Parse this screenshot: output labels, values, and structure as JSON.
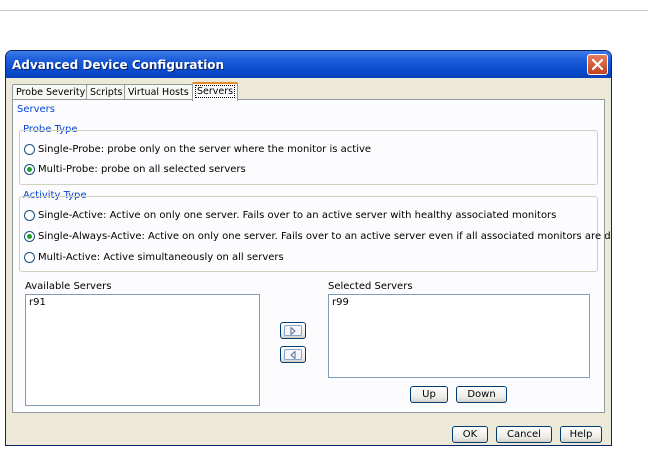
{
  "dialog": {
    "title": "Advanced Device Configuration"
  },
  "tabs": [
    "Probe Severity",
    "Scripts",
    "Virtual Hosts",
    "Servers"
  ],
  "active_tab": "Servers",
  "servers_section": {
    "title": "Servers",
    "probe_type": {
      "title": "Probe Type",
      "options": [
        {
          "label": "Single-Probe: probe only on the server where the monitor is active",
          "selected": false
        },
        {
          "label": "Multi-Probe: probe on all selected servers",
          "selected": true
        }
      ]
    },
    "activity_type": {
      "title": "Activity Type",
      "options": [
        {
          "label": "Single-Active: Active on only one server. Fails over to an active server with healthy associated monitors",
          "selected": false
        },
        {
          "label": "Single-Always-Active: Active on only one server. Fails over to an active server even if all associated monitors are down",
          "selected": true
        },
        {
          "label": "Multi-Active: Active simultaneously on all servers",
          "selected": false
        }
      ]
    },
    "available_servers": {
      "label": "Available Servers",
      "items": [
        "r91"
      ]
    },
    "selected_servers": {
      "label": "Selected Servers",
      "items": [
        "r99"
      ]
    },
    "up_label": "Up",
    "down_label": "Down"
  },
  "footer": {
    "ok_label": "OK",
    "cancel_label": "Cancel",
    "help_label": "Help"
  },
  "colors": {
    "titlebar": "#0a4cd0",
    "group_title": "#0046d5",
    "active_tab_accent": "#e68b2c",
    "radio_selected": "#21a121",
    "close_button": "#c2431e"
  },
  "icons": [
    "close-icon",
    "arrow-right-icon",
    "arrow-left-icon"
  ]
}
